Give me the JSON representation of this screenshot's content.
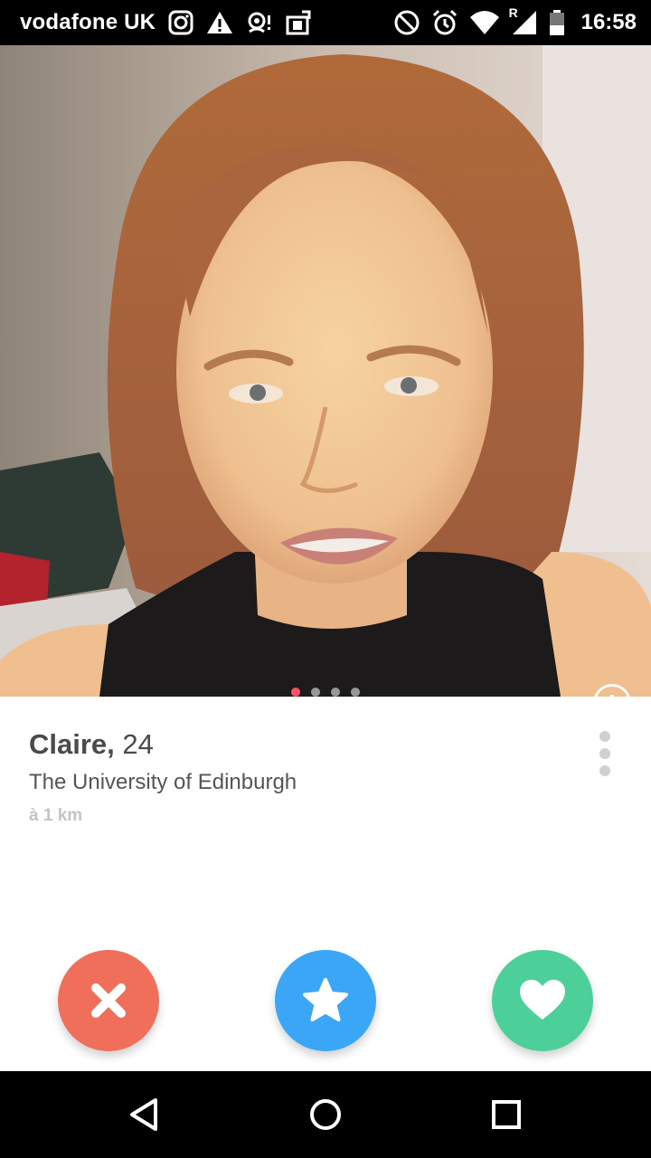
{
  "status_bar": {
    "carrier": "vodafone UK",
    "time": "16:58",
    "network_badge": "R",
    "icons": [
      "instagram-icon",
      "warning-icon",
      "location-icon",
      "upload-icon",
      "blocked-icon",
      "alarm-icon",
      "wifi-icon",
      "signal-icon",
      "battery-icon"
    ]
  },
  "profile": {
    "name": "Claire,",
    "age": "24",
    "school": "The University of Edinburgh",
    "distance": "à 1 km",
    "photo_count": 4,
    "active_photo": 1
  },
  "actions": {
    "nope": {
      "icon": "close-icon",
      "color": "#ef6f5b"
    },
    "super_like": {
      "icon": "star-icon",
      "color": "#3aa6f5"
    },
    "like": {
      "icon": "heart-icon",
      "color": "#4ccf98"
    }
  },
  "colors": {
    "accent_dot": "#fd5068",
    "text_primary": "#4a4a4a",
    "text_muted": "#c4c4c4"
  },
  "nav_bar": {
    "icons": [
      "back-icon",
      "home-icon",
      "recents-icon"
    ]
  }
}
